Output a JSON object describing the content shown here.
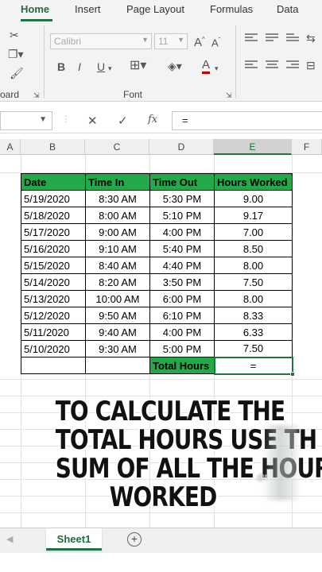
{
  "ribbon_tabs": [
    "Home",
    "Insert",
    "Page Layout",
    "Formulas",
    "Data"
  ],
  "ribbon": {
    "font_name": "Calibri",
    "font_size": "11",
    "font_group_label": "Font",
    "clipboard_group_label": "oard",
    "bold": "B",
    "italic": "I",
    "underline": "U",
    "grow_font": "A",
    "shrink_font": "A",
    "font_color": "A"
  },
  "formula_bar": {
    "cancel": "✕",
    "enter": "✓",
    "fx": "fx",
    "value": "="
  },
  "columns": [
    "A",
    "B",
    "C",
    "D",
    "E",
    "F"
  ],
  "table": {
    "headers": [
      "Date",
      "Time In",
      "Time Out",
      "Hours Worked"
    ],
    "rows": [
      [
        "5/19/2020",
        "8:30 AM",
        "5:30 PM",
        "9.00"
      ],
      [
        "5/18/2020",
        "8:00 AM",
        "5:10 PM",
        "9.17"
      ],
      [
        "5/17/2020",
        "9:00 AM",
        "4:00 PM",
        "7.00"
      ],
      [
        "5/16/2020",
        "9:10 AM",
        "5:40 PM",
        "8.50"
      ],
      [
        "5/15/2020",
        "8:40 AM",
        "4:40 PM",
        "8.00"
      ],
      [
        "5/14/2020",
        "8:20 AM",
        "3:50 PM",
        "7.50"
      ],
      [
        "5/13/2020",
        "10:00 AM",
        "6:00 PM",
        "8.00"
      ],
      [
        "5/12/2020",
        "9:50 AM",
        "6:10 PM",
        "8.33"
      ],
      [
        "5/11/2020",
        "9:40 AM",
        "4:00 PM",
        "6.33"
      ],
      [
        "5/10/2020",
        "9:30 AM",
        "5:00 PM",
        "7.50"
      ]
    ],
    "total_label": "Total Hours",
    "total_value": "="
  },
  "caption": [
    "TO CALCULATE THE",
    "TOTAL HOURS USE TH",
    "SUM OF ALL THE HOUR",
    "WORKED"
  ],
  "watermark": "@t",
  "sheet_bar": {
    "sheet_name": "Sheet1",
    "add_sheet": "+",
    "nav": "◀"
  },
  "colors": {
    "header_green": "#22a94a",
    "excel_green": "#217346"
  }
}
